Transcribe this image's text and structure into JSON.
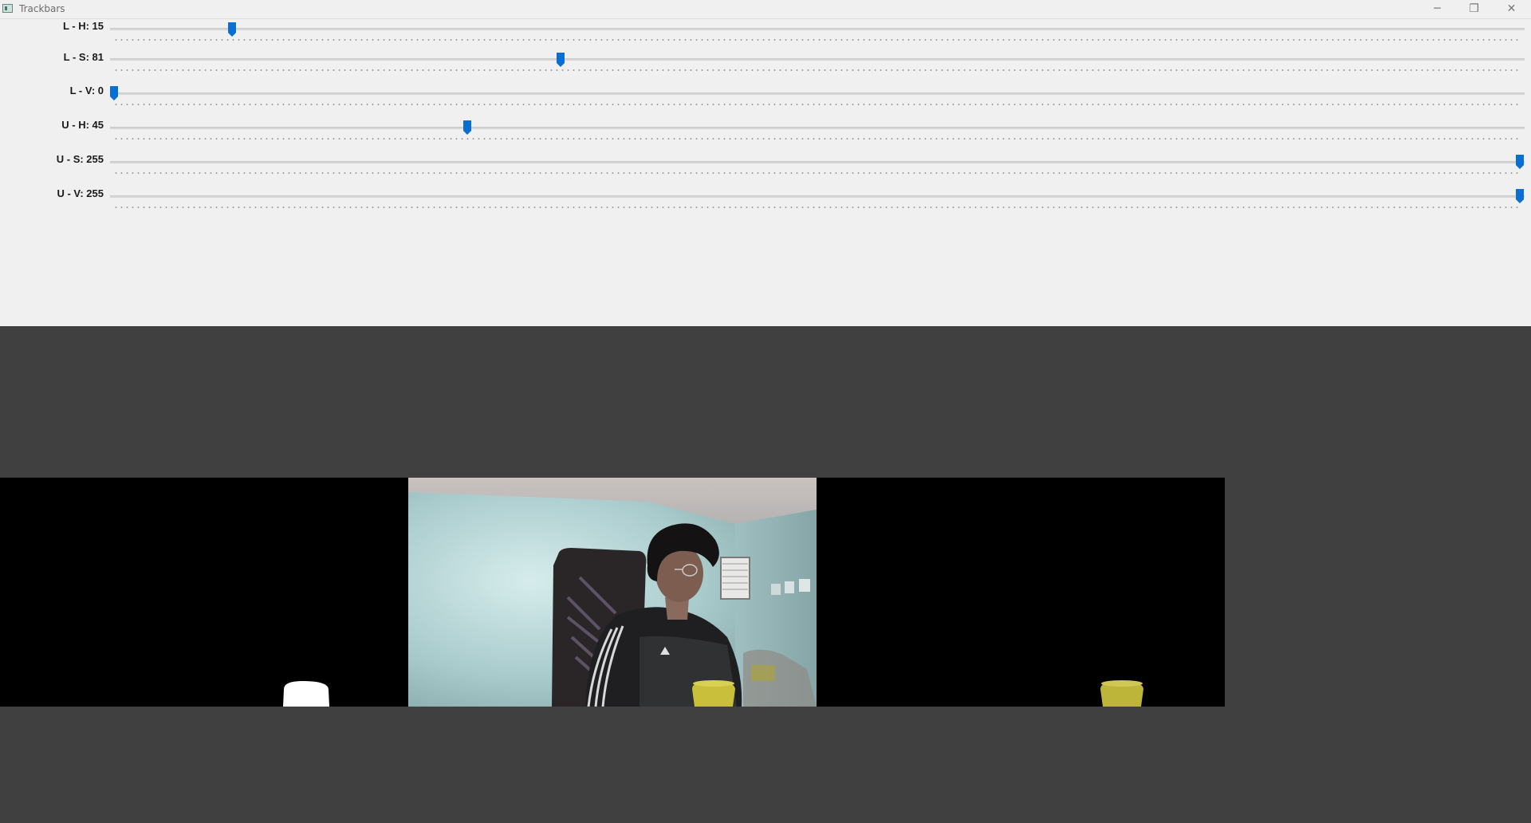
{
  "window": {
    "title": "Trackbars",
    "minimize_glyph": "─",
    "restore_glyph": "❐",
    "close_glyph": "✕"
  },
  "trackbars": [
    {
      "label": "L - H: 15",
      "value": 15,
      "max": 179
    },
    {
      "label": "L - S: 81",
      "value": 81,
      "max": 255
    },
    {
      "label": "L - V: 0",
      "value": 0,
      "max": 255
    },
    {
      "label": "U - H: 45",
      "value": 45,
      "max": 179
    },
    {
      "label": "U - S: 255",
      "value": 255,
      "max": 255
    },
    {
      "label": "U - V: 255",
      "value": 255,
      "max": 255
    }
  ],
  "colors": {
    "thumb": "#0a6fd0",
    "panel_bg": "#f0f0f0",
    "video_bg": "#404040"
  },
  "icons": {
    "app": "app-window-icon",
    "thumb": "slider-thumb-icon"
  }
}
